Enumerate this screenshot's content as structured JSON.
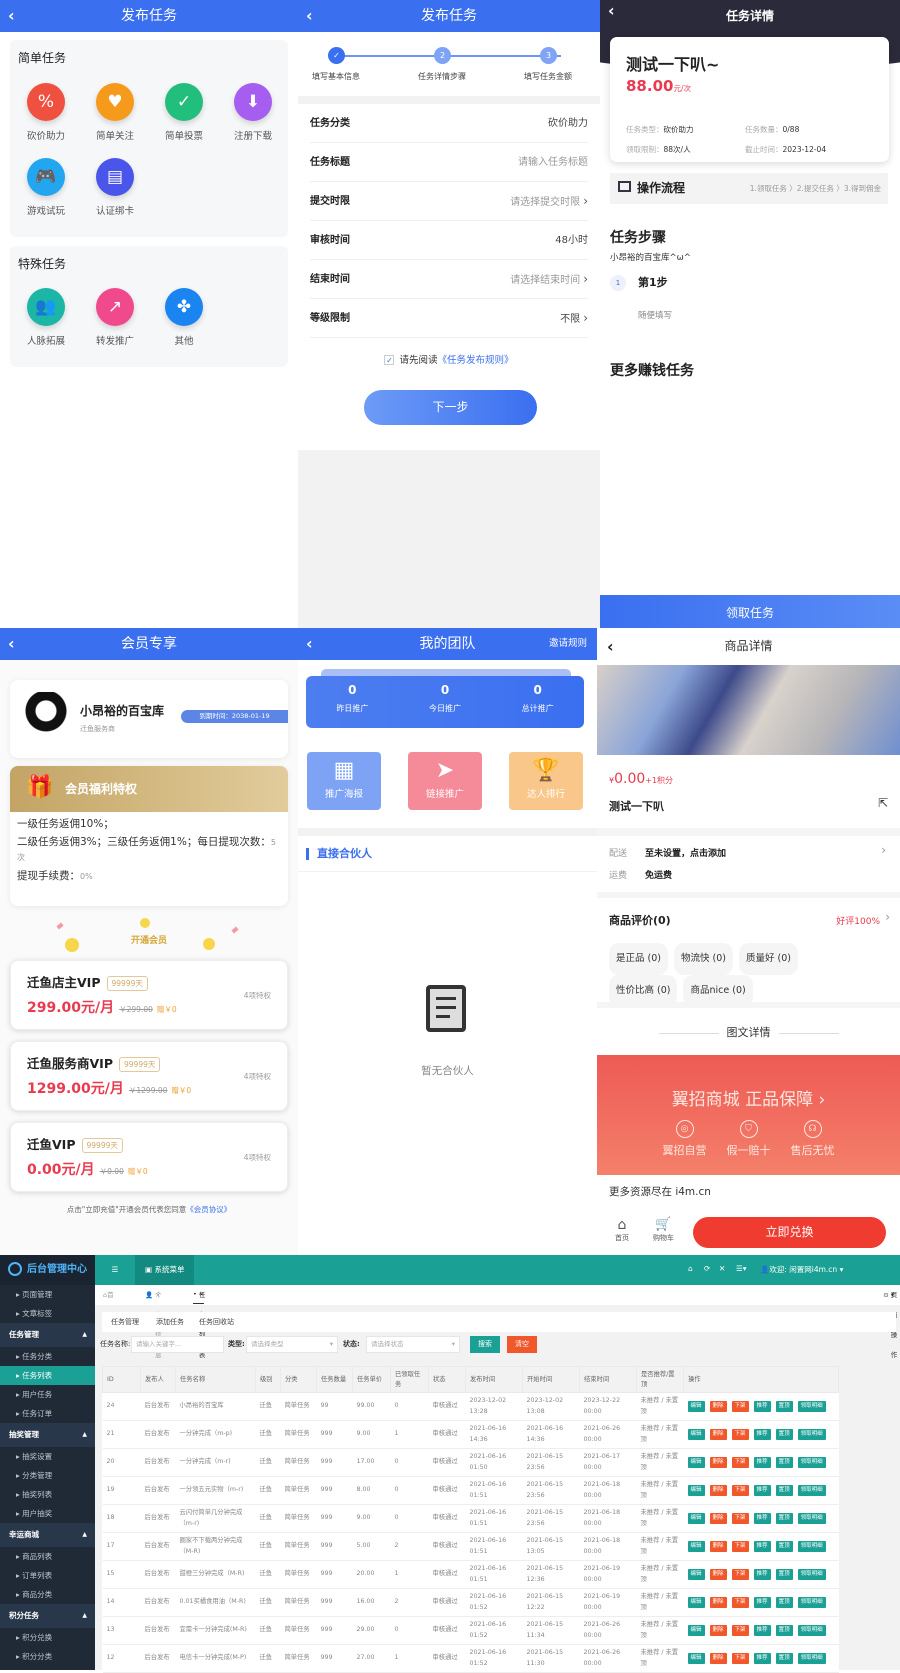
{
  "colors": {
    "primary": "#3a6ff0",
    "dark_header": "#2a2a3a",
    "red": "#e83b4f",
    "gold": "#c9ad70",
    "teal": "#1aa094",
    "orange": "#f0572b",
    "sidebar": "#1f2a36"
  },
  "publish": {
    "title": "发布任务",
    "back_icon": "chevron-left-icon",
    "simple_title": "简单任务",
    "simple_items": [
      {
        "label": "砍价助力",
        "icon": "price-tag-icon",
        "color": "#f0503f"
      },
      {
        "label": "简单关注",
        "icon": "heart-plus-icon",
        "color": "#f59a1b"
      },
      {
        "label": "简单投票",
        "icon": "vote-box-icon",
        "color": "#22bf7c"
      },
      {
        "label": "注册下载",
        "icon": "download-icon",
        "color": "#a55ef0"
      },
      {
        "label": "游戏试玩",
        "icon": "gamepad-icon",
        "color": "#23a6f0"
      },
      {
        "label": "认证绑卡",
        "icon": "card-link-icon",
        "color": "#4a55ea"
      }
    ],
    "special_title": "特殊任务",
    "special_items": [
      {
        "label": "人脉拓展",
        "icon": "people-icon",
        "color": "#1bb6a6"
      },
      {
        "label": "转发推广",
        "icon": "share-icon",
        "color": "#f04a8c"
      },
      {
        "label": "其他",
        "icon": "grid-icon",
        "color": "#1a84f0"
      }
    ]
  },
  "form": {
    "title": "发布任务",
    "steps": [
      {
        "num": "✓",
        "label": "填写基本信息"
      },
      {
        "num": "2",
        "label": "任务详情步骤"
      },
      {
        "num": "3",
        "label": "填写任务金额"
      }
    ],
    "rows": [
      {
        "label": "任务分类",
        "value": "砍价助力",
        "placeholder": false,
        "arrow": false
      },
      {
        "label": "任务标题",
        "value": "请输入任务标题",
        "placeholder": true,
        "arrow": false
      },
      {
        "label": "提交时限",
        "value": "请选择提交时限",
        "placeholder": true,
        "arrow": true
      },
      {
        "label": "审核时间",
        "value": "48小时",
        "placeholder": false,
        "arrow": false
      },
      {
        "label": "结束时间",
        "value": "请选择结束时间",
        "placeholder": true,
        "arrow": true
      },
      {
        "label": "等级限制",
        "value": "不限",
        "placeholder": false,
        "arrow": true
      }
    ],
    "agree_prefix": "请先阅读",
    "agree_link": "《任务发布规则》",
    "agree_checked": true,
    "next_button": "下一步"
  },
  "detail": {
    "title": "任务详情",
    "task_title": "测试一下叭~",
    "price": "88.00",
    "price_unit": "元/次",
    "meta": [
      {
        "k": "任务类型：",
        "v": "砍价助力"
      },
      {
        "k": "任务数量：",
        "v": "0/88"
      },
      {
        "k": "领取限制：",
        "v": "88次/人"
      },
      {
        "k": "截止时间：",
        "v": "2023-12-04"
      }
    ],
    "flow_title": "操作流程",
    "flow_steps": "1.领取任务 〉2.提交任务 〉3.得到佣金",
    "steps_title": "任务步骤",
    "steps_sub": "小昂裕的百宝库^ω^",
    "step_num": "1",
    "step_name": "第1步",
    "step_desc": "随便填写",
    "more_title": "更多赚钱任务",
    "claim_button": "领取任务"
  },
  "member": {
    "title": "会员专享",
    "name": "小昂裕的百宝库",
    "role": "迁鱼服务商",
    "expire": "到期时间：2038-01-19",
    "benefit_title": "会员福利特权",
    "benefit_lines": [
      {
        "text": "一级任务返佣10%；",
        "extra": ""
      },
      {
        "text": "二级任务返佣3%；三级任务返佣1%；每日提现次数：",
        "extra": "5次"
      },
      {
        "text": "提现手续费：",
        "extra": "0%"
      }
    ],
    "open_label": "开通会员",
    "plans": [
      {
        "name": "迁鱼店主VIP",
        "days": "99999天",
        "price": "299.00元/月",
        "orig": "￥299.00",
        "gift": "赠￥0",
        "rights": "4项特权"
      },
      {
        "name": "迁鱼服务商VIP",
        "days": "99999天",
        "price": "1299.00元/月",
        "orig": "￥1299.00",
        "gift": "赠￥0",
        "rights": "4项特权"
      },
      {
        "name": "迁鱼VIP",
        "days": "99999天",
        "price": "0.00元/月",
        "orig": "￥0.00",
        "gift": "赠￥0",
        "rights": "4项特权"
      }
    ],
    "footer_text": "点击\"立即充值\"开通会员代表您同意",
    "footer_link": "《会员协议》"
  },
  "team": {
    "title": "我的团队",
    "rules": "邀请规则",
    "stats": [
      {
        "value": "0",
        "label": "昨日推广"
      },
      {
        "value": "0",
        "label": "今日推广"
      },
      {
        "value": "0",
        "label": "总计推广"
      }
    ],
    "tiles": [
      {
        "label": "推广海报",
        "icon": "qrcode-icon",
        "color": "#7ea3f5"
      },
      {
        "label": "链接推广",
        "icon": "paper-plane-icon",
        "color": "#f58a98"
      },
      {
        "label": "达人排行",
        "icon": "trophy-icon",
        "color": "#f9c78a"
      }
    ],
    "partners_title": "直接合伙人",
    "empty_text": "暂无合伙人"
  },
  "product": {
    "title": "商品详情",
    "price": "0.00",
    "price_symbol": "¥",
    "points": "+1积分",
    "name": "测试一下叭",
    "ship_k": "配送",
    "ship_v": "至未设置，点击添加",
    "fee_k": "运费",
    "fee_v": "免运费",
    "review_title": "商品评价(0)",
    "good_rate": "好评100%",
    "tags": [
      "是正品 (0)",
      "物流快 (0)",
      "质量好 (0)",
      "性价比高 (0)",
      "商品nice (0)"
    ],
    "detail_title": "图文详情",
    "banner_title": "翼招商城 正品保障 ›",
    "banner_items": [
      {
        "label": "翼招自营",
        "icon": "shop-icon"
      },
      {
        "label": "假一赔十",
        "icon": "shield-check-icon"
      },
      {
        "label": "售后无忧",
        "icon": "headset-icon"
      }
    ],
    "more_text": "更多资源尽在 i4m.cn",
    "nav_home": "首页",
    "nav_cart": "购物车",
    "exchange_button": "立即兑换"
  },
  "admin": {
    "logo": "后台管理中心",
    "sidebar": [
      {
        "type": "item",
        "label": "页面管理"
      },
      {
        "type": "item",
        "label": "文章标签"
      },
      {
        "type": "group",
        "label": "任务管理"
      },
      {
        "type": "item",
        "label": "任务分类"
      },
      {
        "type": "item",
        "label": "任务列表",
        "active": true
      },
      {
        "type": "item",
        "label": "用户任务"
      },
      {
        "type": "item",
        "label": "任务订单"
      },
      {
        "type": "group",
        "label": "抽奖管理"
      },
      {
        "type": "item",
        "label": "抽奖设置"
      },
      {
        "type": "item",
        "label": "分类管理"
      },
      {
        "type": "item",
        "label": "抽奖列表"
      },
      {
        "type": "item",
        "label": "用户抽奖"
      },
      {
        "type": "group",
        "label": "幸运商城"
      },
      {
        "type": "item",
        "label": "商品列表"
      },
      {
        "type": "item",
        "label": "订单列表"
      },
      {
        "type": "item",
        "label": "商品分类"
      },
      {
        "type": "group",
        "label": "积分任务"
      },
      {
        "type": "item",
        "label": "积分兑换"
      },
      {
        "type": "item",
        "label": "积分分类"
      }
    ],
    "top_menu": "系统菜单",
    "welcome": "欢迎: 闲置网i4m.cn",
    "crumbs": [
      "首页",
      "个人信息",
      "任务列表"
    ],
    "page_ops": "页面操作",
    "subtabs": [
      "任务管理",
      "添加任务",
      "任务回收站"
    ],
    "filter": {
      "name_label": "任务名称:",
      "name_ph": "请输入关键字...",
      "type_label": "类型:",
      "type_ph": "请选择类型",
      "status_label": "状态:",
      "status_ph": "请选择状态",
      "search": "搜索",
      "clear": "清空"
    },
    "columns": [
      "ID",
      "发布人",
      "任务名称",
      "级别",
      "分类",
      "任务数量",
      "任务单价",
      "已领取任务",
      "状态",
      "发布时间",
      "开始时间",
      "结束时间",
      "是否推荐/置顶",
      "操作"
    ],
    "ops": [
      {
        "label": "编辑",
        "color": "#1aa094"
      },
      {
        "label": "删除",
        "color": "#f0572b"
      },
      {
        "label": "下架",
        "color": "#f0572b"
      },
      {
        "label": "推荐",
        "color": "#1aa094"
      },
      {
        "label": "置顶",
        "color": "#1aa094"
      },
      {
        "label": "领取明细",
        "color": "#1aa094"
      }
    ],
    "rows": [
      [
        "24",
        "后台发布",
        "小昂裕的百宝库",
        "迁鱼",
        "简单任务",
        "99",
        "99.00",
        "0",
        "审核通过",
        "2023-12-02 13:28",
        "2023-12-02 13:08",
        "2023-12-22 00:00",
        "未推荐 / 未置顶"
      ],
      [
        "21",
        "后台发布",
        "一分钟完成（m-p)",
        "迁鱼",
        "简单任务",
        "999",
        "9.00",
        "1",
        "审核通过",
        "2021-06-16 14:36",
        "2021-06-16 14:36",
        "2021-06-26 00:00",
        "未推荐 / 未置顶"
      ],
      [
        "20",
        "后台发布",
        "一分钟完成（m-r)",
        "迁鱼",
        "简单任务",
        "999",
        "17.00",
        "0",
        "审核通过",
        "2021-06-16 01:50",
        "2021-06-15 23:56",
        "2021-06-17 00:00",
        "未推荐 / 未置顶"
      ],
      [
        "19",
        "后台发布",
        "一分领五元实物（m-r)",
        "迁鱼",
        "简单任务",
        "999",
        "8.00",
        "0",
        "审核通过",
        "2021-06-16 01:51",
        "2021-06-15 23:56",
        "2021-06-18 00:00",
        "未推荐 / 未置顶"
      ],
      [
        "18",
        "后台发布",
        "云闪付简单几分钟完成（m-r)",
        "迁鱼",
        "简单任务",
        "999",
        "9.00",
        "0",
        "审核通过",
        "2021-06-16 01:51",
        "2021-06-15 23:56",
        "2021-06-18 00:00",
        "未推荐 / 未置顶"
      ],
      [
        "17",
        "后台发布",
        "圈家不下载两分钟完成（M-R)",
        "迁鱼",
        "简单任务",
        "999",
        "5.00",
        "2",
        "审核通过",
        "2021-06-16 01:51",
        "2021-06-15 13:05",
        "2021-06-18 00:00",
        "未推荐 / 未置顶"
      ],
      [
        "15",
        "后台发布",
        "甜橙三分钟完成（M-R)",
        "迁鱼",
        "简单任务",
        "999",
        "20.00",
        "1",
        "审核通过",
        "2021-06-16 01:51",
        "2021-06-15 12:36",
        "2021-06-19 00:00",
        "未推荐 / 未置顶"
      ],
      [
        "14",
        "后台发布",
        "0.01买橘食用油（M-R)",
        "迁鱼",
        "简单任务",
        "999",
        "16.00",
        "2",
        "审核通过",
        "2021-06-16 01:52",
        "2021-06-15 12:22",
        "2021-06-19 00:00",
        "未推荐 / 未置顶"
      ],
      [
        "13",
        "后台发布",
        "宜需卡一分钟完成(M-R)",
        "迁鱼",
        "简单任务",
        "999",
        "29.00",
        "0",
        "审核通过",
        "2021-06-16 01:52",
        "2021-06-15 11:34",
        "2021-06-26 00:00",
        "未推荐 / 未置顶"
      ],
      [
        "12",
        "后台发布",
        "电信卡一分钟完成(M-P)",
        "迁鱼",
        "简单任务",
        "999",
        "27.00",
        "1",
        "审核通过",
        "2021-06-16 01:52",
        "2021-06-15 11:30",
        "2021-06-26 00:00",
        "未推荐 / 未置顶"
      ]
    ]
  }
}
